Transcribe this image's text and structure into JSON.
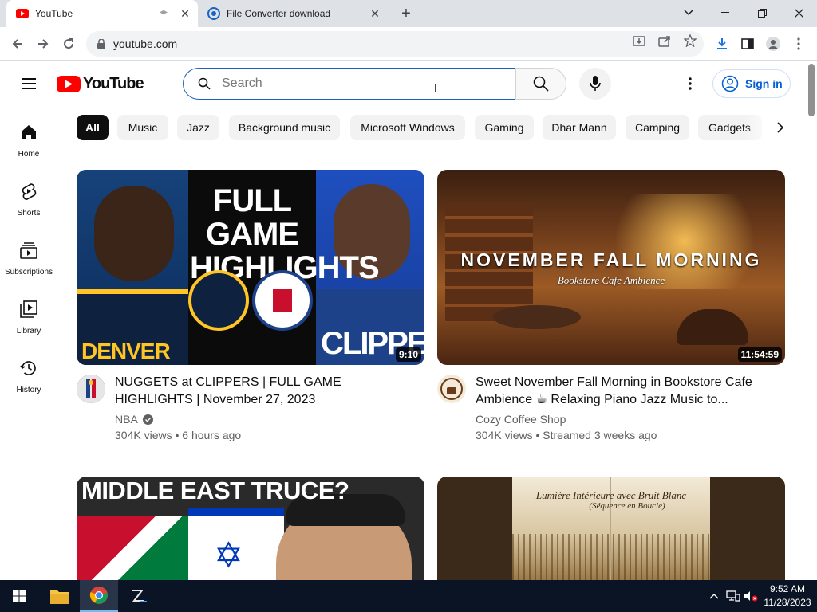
{
  "browser": {
    "tabs": [
      {
        "title": "YouTube",
        "active": true
      },
      {
        "title": "File Converter download",
        "active": false
      }
    ],
    "url": "youtube.com"
  },
  "masthead": {
    "logo_text": "YouTube",
    "search_placeholder": "Search",
    "sign_in_label": "Sign in"
  },
  "guide": {
    "items": [
      {
        "label": "Home",
        "icon": "home-icon"
      },
      {
        "label": "Shorts",
        "icon": "shorts-icon"
      },
      {
        "label": "Subscriptions",
        "icon": "subscriptions-icon"
      },
      {
        "label": "Library",
        "icon": "library-icon"
      },
      {
        "label": "History",
        "icon": "history-icon"
      }
    ]
  },
  "chips": [
    "All",
    "Music",
    "Jazz",
    "Background music",
    "Microsoft Windows",
    "Gaming",
    "Dhar Mann",
    "Camping",
    "Gadgets"
  ],
  "videos": [
    {
      "title": "NUGGETS at CLIPPERS | FULL GAME HIGHLIGHTS | November 27, 2023",
      "channel": "NBA",
      "verified": true,
      "meta": "304K views • 6 hours ago",
      "duration": "9:10",
      "thumb_text": {
        "headline": "FULL GAME HIGHLIGHTS",
        "left_team": "DENVER",
        "right_team": "CLIPPERS"
      }
    },
    {
      "title": "Sweet November Fall Morning in Bookstore Cafe Ambience ☕ Relaxing Piano Jazz Music to...",
      "channel": "Cozy Coffee Shop",
      "verified": false,
      "meta": "304K views • Streamed 3 weeks ago",
      "duration": "11:54:59",
      "thumb_text": {
        "headline": "NOVEMBER FALL MORNING",
        "sub": "Bookstore Cafe Ambience"
      }
    },
    {
      "thumb_text": {
        "headline": "MIDDLE EAST TRUCE?"
      }
    },
    {
      "thumb_text": {
        "line1": "Lumière Intérieure avec Bruit Blanc",
        "line2": "(Séquence en Boucle)"
      }
    }
  ],
  "taskbar": {
    "time": "9:52 AM",
    "date": "11/28/2023"
  },
  "colors": {
    "yt_red": "#ff0000",
    "link_blue": "#065fd4",
    "taskbar_bg": "#0b1424"
  }
}
